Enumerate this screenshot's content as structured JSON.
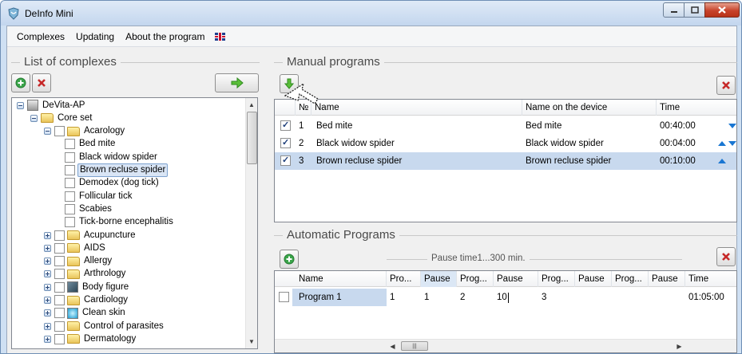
{
  "window": {
    "title": "DeInfo Mini"
  },
  "menu": {
    "items": [
      "Complexes",
      "Updating",
      "About the program"
    ]
  },
  "left": {
    "group_title": "List of complexes",
    "tree": [
      {
        "label": "DeVita-AP",
        "level": 0,
        "expander": "minus",
        "icon": "device"
      },
      {
        "label": "Core set",
        "level": 1,
        "expander": "minus",
        "icon": "folder"
      },
      {
        "label": "Acarology",
        "level": 2,
        "expander": "minus",
        "checkbox": true,
        "icon": "folder"
      },
      {
        "label": "Bed mite",
        "level": 3,
        "checkbox": true
      },
      {
        "label": "Black widow spider",
        "level": 3,
        "checkbox": true
      },
      {
        "label": "Brown recluse spider",
        "level": 3,
        "checkbox": true,
        "selected": true
      },
      {
        "label": "Demodex (dog tick)",
        "level": 3,
        "checkbox": true
      },
      {
        "label": "Follicular tick",
        "level": 3,
        "checkbox": true
      },
      {
        "label": "Scabies",
        "level": 3,
        "checkbox": true
      },
      {
        "label": "Tick-borne encephalitis",
        "level": 3,
        "checkbox": true
      },
      {
        "label": "Acupuncture",
        "level": 2,
        "expander": "plus",
        "checkbox": true,
        "icon": "folder"
      },
      {
        "label": "AIDS",
        "level": 2,
        "expander": "plus",
        "checkbox": true,
        "icon": "folder"
      },
      {
        "label": "Allergy",
        "level": 2,
        "expander": "plus",
        "checkbox": true,
        "icon": "folder"
      },
      {
        "label": "Arthrology",
        "level": 2,
        "expander": "plus",
        "checkbox": true,
        "icon": "folder"
      },
      {
        "label": "Body figure",
        "level": 2,
        "expander": "plus",
        "checkbox": true,
        "icon": "body"
      },
      {
        "label": "Cardiology",
        "level": 2,
        "expander": "plus",
        "checkbox": true,
        "icon": "folder"
      },
      {
        "label": "Clean skin",
        "level": 2,
        "expander": "plus",
        "checkbox": true,
        "icon": "skin"
      },
      {
        "label": "Control of parasites",
        "level": 2,
        "expander": "plus",
        "checkbox": true,
        "icon": "folder"
      },
      {
        "label": "Dermatology",
        "level": 2,
        "expander": "plus",
        "checkbox": true,
        "icon": "folder"
      }
    ]
  },
  "manual": {
    "group_title": "Manual programs",
    "columns": [
      "№",
      "Name",
      "Name on the device",
      "Time"
    ],
    "rows": [
      {
        "checked": true,
        "num": "1",
        "name": "Bed mite",
        "device_name": "Bed mite",
        "time": "00:40:00",
        "up": false,
        "down": true,
        "selected": false
      },
      {
        "checked": true,
        "num": "2",
        "name": "Black widow spider",
        "device_name": "Black widow spider",
        "time": "00:04:00",
        "up": true,
        "down": true,
        "selected": false
      },
      {
        "checked": true,
        "num": "3",
        "name": "Brown recluse spider",
        "device_name": "Brown recluse spider",
        "time": "00:10:00",
        "up": true,
        "down": false,
        "selected": true
      }
    ]
  },
  "automatic": {
    "group_title": "Automatic Programs",
    "pause_label": "Pause time1...300 min.",
    "columns": [
      "Name",
      "Pro...",
      "Pause",
      "Prog...",
      "Pause",
      "Prog...",
      "Pause",
      "Prog...",
      "Pause",
      "Time"
    ],
    "rows": [
      {
        "checked": false,
        "cells": [
          "Program 1",
          "1",
          "1",
          "2",
          "10",
          "3",
          "",
          "",
          "",
          "01:05:00"
        ]
      }
    ]
  },
  "colors": {
    "accent_blue": "#1976d2",
    "selection": "#c8d9ee",
    "close_red": "#c7432b"
  }
}
